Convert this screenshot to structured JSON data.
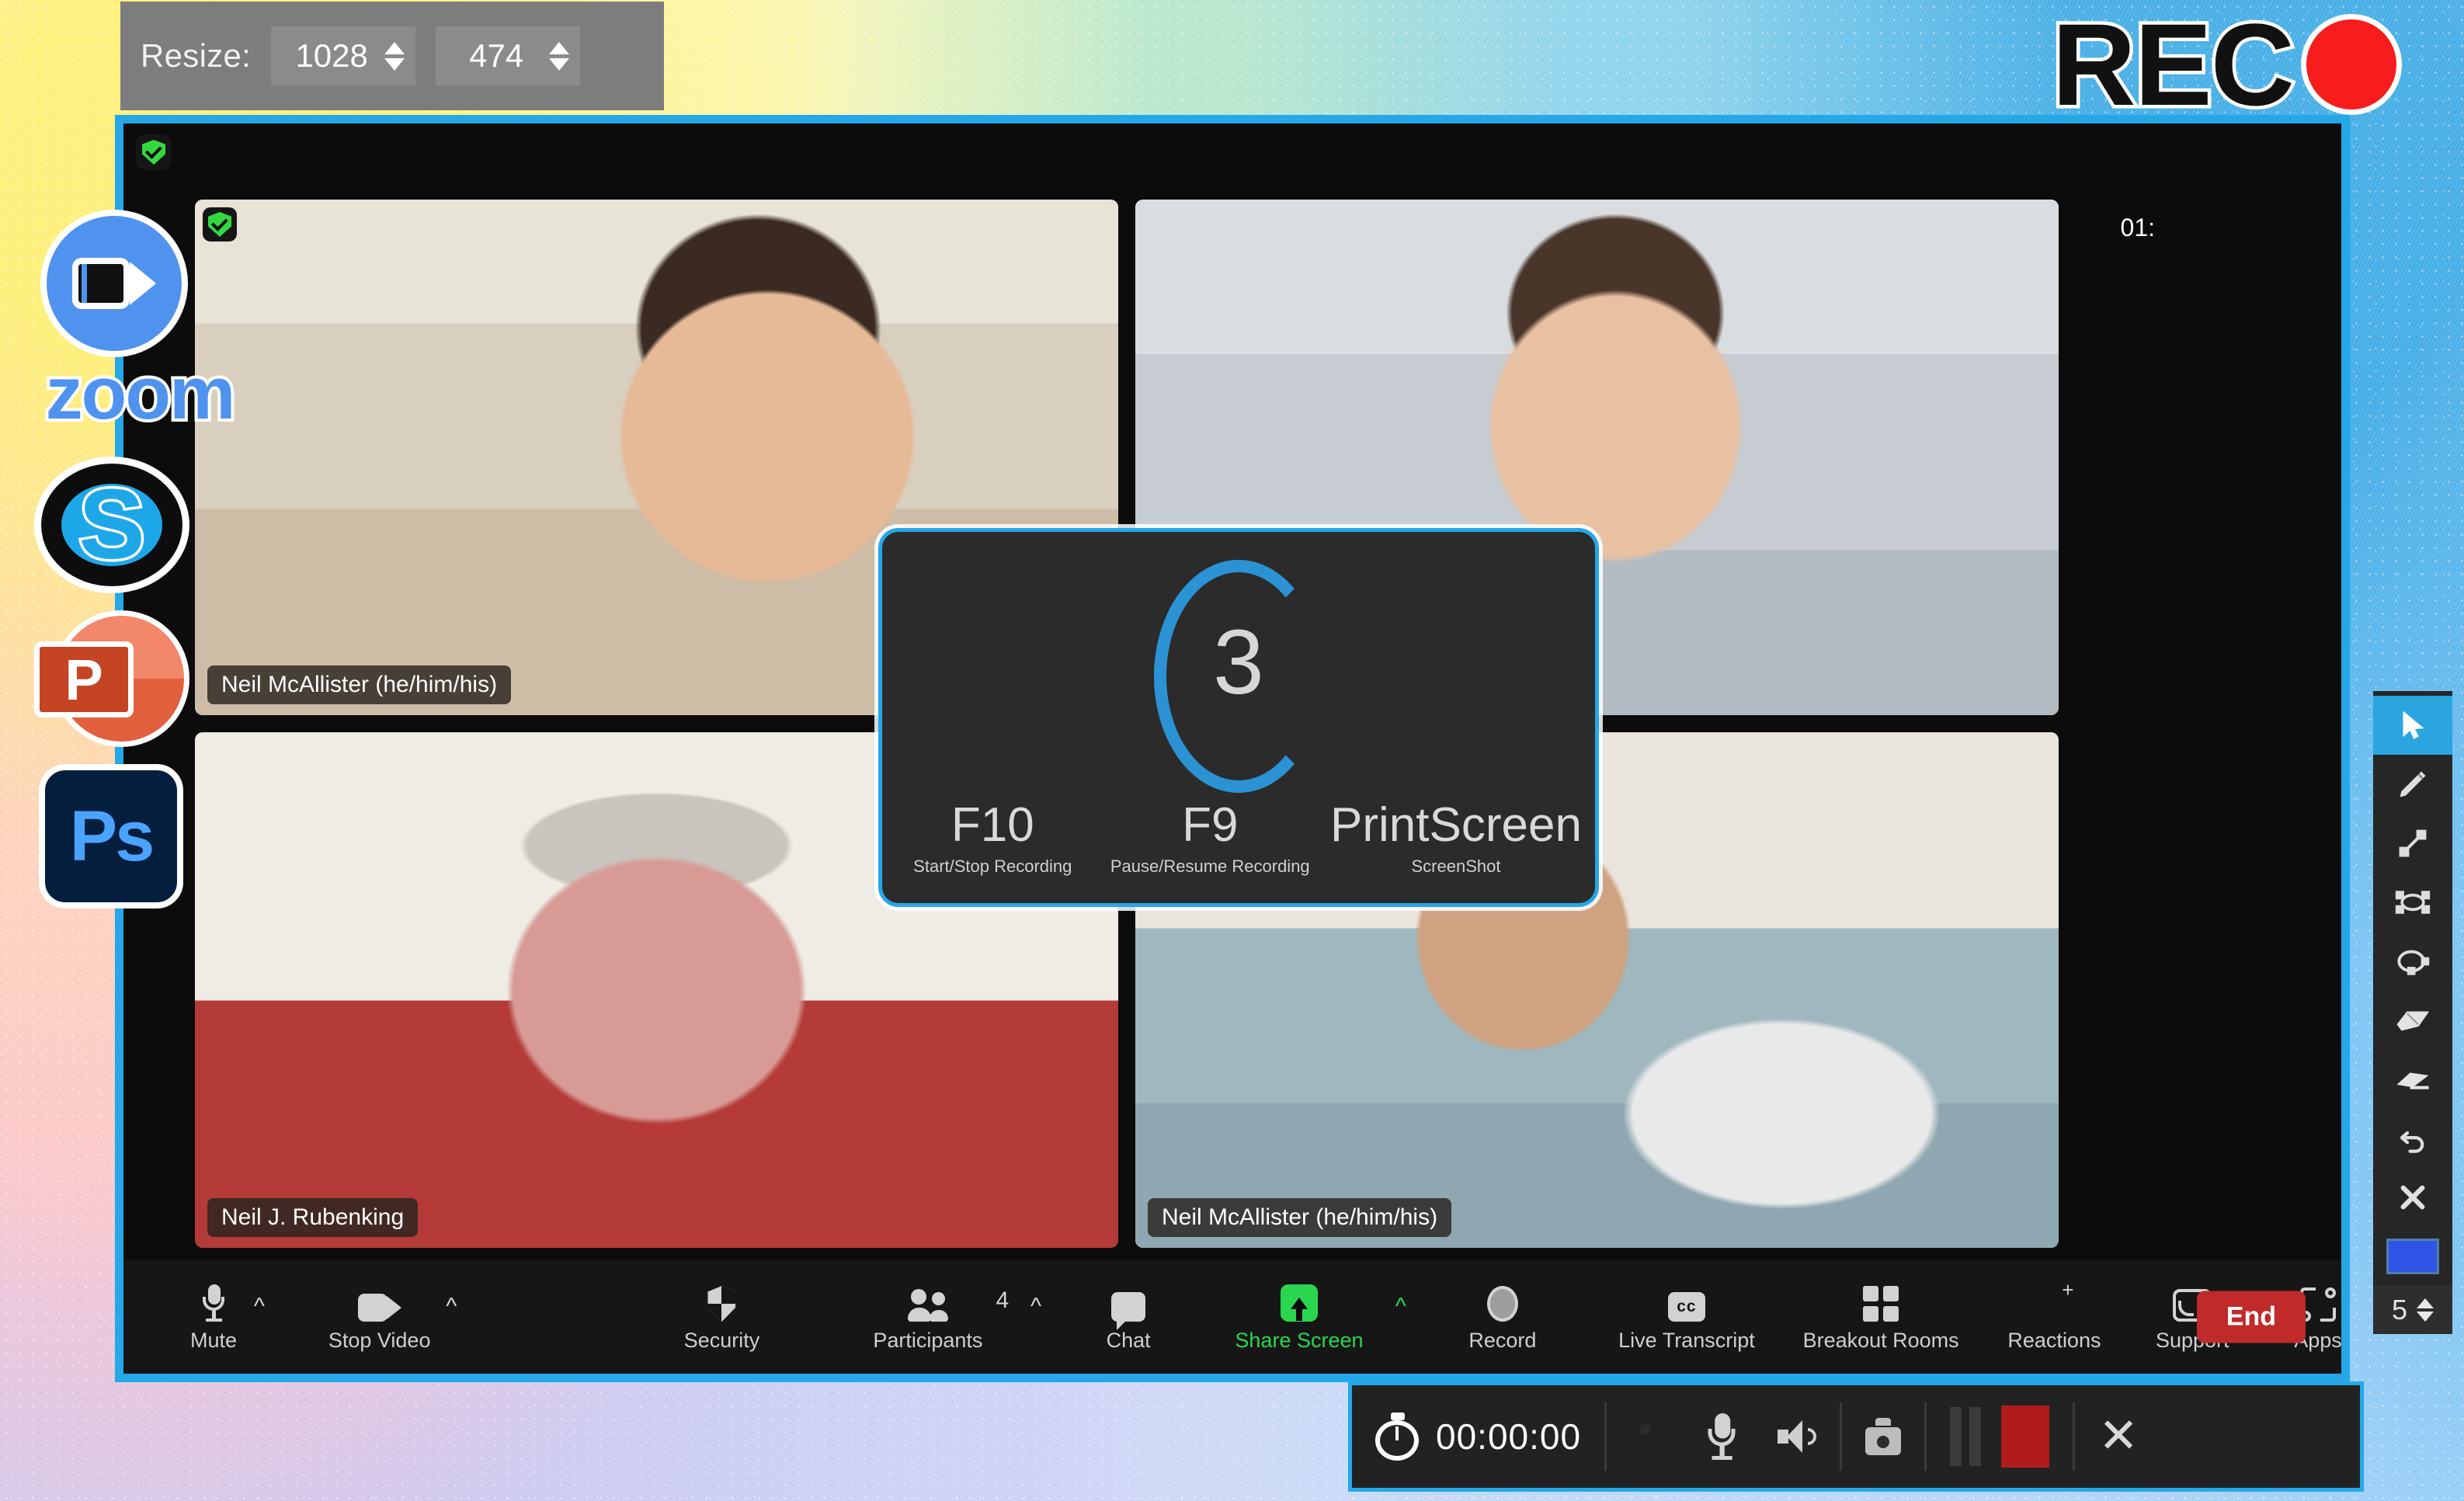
{
  "resize_bar": {
    "label": "Resize:",
    "width_value": "1028",
    "height_value": "474"
  },
  "rec_badge": {
    "text": "REC",
    "timestamp": "01:"
  },
  "app_rail": [
    {
      "name": "zoom",
      "wordmark": "zoom"
    },
    {
      "name": "skype",
      "glyph": "S"
    },
    {
      "name": "powerpoint",
      "glyph": "P"
    },
    {
      "name": "photoshop",
      "glyph": "Ps"
    }
  ],
  "meeting": {
    "tiles": [
      {
        "name": "Neil McAllister (he/him/his)",
        "active": false,
        "has_shield": true
      },
      {
        "name": "",
        "active": true,
        "has_shield": false
      },
      {
        "name": "Neil J. Rubenking",
        "active": false,
        "has_shield": false
      },
      {
        "name": "Neil McAllister (he/him/his)",
        "active": false,
        "has_shield": false
      }
    ]
  },
  "countdown": {
    "number": "3",
    "keys": [
      {
        "key": "F10",
        "desc": "Start/Stop Recording"
      },
      {
        "key": "F9",
        "desc": "Pause/Resume Recording"
      },
      {
        "key": "PrintScreen",
        "desc": "ScreenShot"
      }
    ]
  },
  "zoom_toolbar": {
    "items": [
      {
        "label": "Mute",
        "icon": "microphone-icon",
        "caret": true
      },
      {
        "label": "Stop Video",
        "icon": "video-camera-icon",
        "caret": true
      },
      {
        "label": "Security",
        "icon": "shield-icon",
        "caret": false
      },
      {
        "label": "Participants",
        "icon": "people-icon",
        "caret": true,
        "count": "4"
      },
      {
        "label": "Chat",
        "icon": "chat-bubble-icon",
        "caret": false
      },
      {
        "label": "Share Screen",
        "icon": "share-screen-icon",
        "caret": true,
        "highlight": "#2bd64f"
      },
      {
        "label": "Record",
        "icon": "record-circle-icon",
        "caret": false
      },
      {
        "label": "Live Transcript",
        "icon": "closed-caption-icon",
        "caret": false
      },
      {
        "label": "Breakout Rooms",
        "icon": "grid-squares-icon",
        "caret": false
      },
      {
        "label": "Reactions",
        "icon": "smiley-plus-icon",
        "caret": false
      },
      {
        "label": "Support",
        "icon": "support-screen-icon",
        "caret": false
      },
      {
        "label": "Apps",
        "icon": "apps-bracket-icon",
        "caret": false
      }
    ],
    "end_label": "End"
  },
  "annotation_toolbar": {
    "tools": [
      {
        "name": "select-arrow-tool",
        "selected": true
      },
      {
        "name": "pencil-tool",
        "selected": false
      },
      {
        "name": "line-tool",
        "selected": false
      },
      {
        "name": "rectangle-tool",
        "selected": false
      },
      {
        "name": "lasso-tool",
        "selected": false
      },
      {
        "name": "eraser-tool",
        "selected": false
      },
      {
        "name": "highlighter-tool",
        "selected": false
      },
      {
        "name": "undo-tool",
        "selected": false
      },
      {
        "name": "clear-tool",
        "selected": false
      }
    ],
    "color_swatch": "#2f55e8",
    "size_value": "5"
  },
  "recorder_bar": {
    "timer": "00:00:00",
    "controls": [
      {
        "name": "webcam-toggle"
      },
      {
        "name": "microphone-toggle"
      },
      {
        "name": "speaker-toggle"
      },
      {
        "name": "screenshot-camera"
      },
      {
        "name": "pause-button"
      },
      {
        "name": "stop-button"
      },
      {
        "name": "close-button"
      }
    ]
  },
  "colors": {
    "accent_blue": "#25a7e8",
    "record_red": "#f81d1d",
    "active_green": "#3ddc55",
    "share_green": "#2bd64f",
    "end_red": "#c02a2a"
  }
}
